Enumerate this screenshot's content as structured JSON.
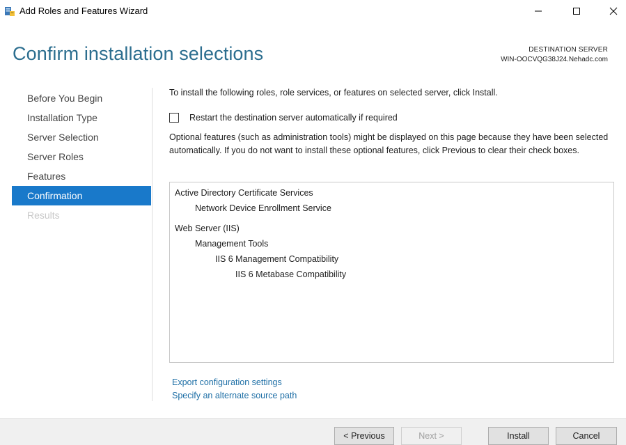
{
  "window": {
    "title": "Add Roles and Features Wizard",
    "icon": "server-manager-icon"
  },
  "header": {
    "title": "Confirm installation selections",
    "destination_label": "DESTINATION SERVER",
    "destination_server": "WIN-OOCVQG38J24.Nehadc.com"
  },
  "nav": {
    "items": [
      {
        "label": "Before You Begin",
        "state": "normal"
      },
      {
        "label": "Installation Type",
        "state": "normal"
      },
      {
        "label": "Server Selection",
        "state": "normal"
      },
      {
        "label": "Server Roles",
        "state": "normal"
      },
      {
        "label": "Features",
        "state": "normal"
      },
      {
        "label": "Confirmation",
        "state": "active"
      },
      {
        "label": "Results",
        "state": "disabled"
      }
    ],
    "active_color": "#1979ca"
  },
  "content": {
    "intro": "To install the following roles, role services, or features on selected server, click Install.",
    "restart_label": "Restart the destination server automatically if required",
    "restart_checked": false,
    "optional_note": "Optional features (such as administration tools) might be displayed on this page because they have been selected automatically. If you do not want to install these optional features, click Previous to clear their check boxes.",
    "selections": [
      "Active Directory Certificate Services",
      "Network Device Enrollment Service",
      "Web Server (IIS)",
      "Management Tools",
      "IIS 6 Management Compatibility",
      "IIS 6 Metabase Compatibility"
    ],
    "export_link": "Export configuration settings",
    "alternate_link": "Specify an alternate source path"
  },
  "buttons": {
    "previous": "< Previous",
    "next": "Next >",
    "install": "Install",
    "cancel": "Cancel"
  }
}
